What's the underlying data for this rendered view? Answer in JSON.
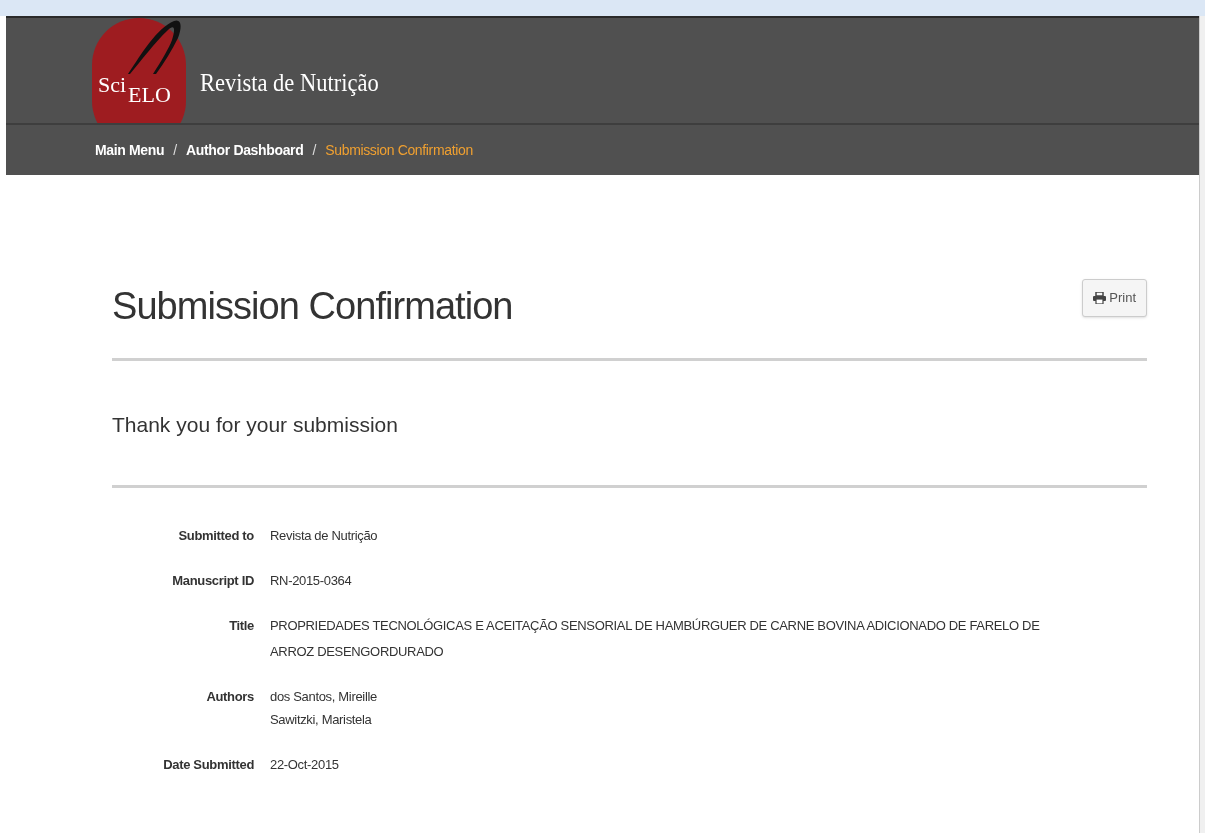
{
  "header": {
    "logo": {
      "part_1": "Sci",
      "part_2": "ELO"
    },
    "journal_title": "Revista de Nutrição"
  },
  "breadcrumb": [
    {
      "label": "Main Menu",
      "current": false
    },
    {
      "label": "Author Dashboard",
      "current": false
    },
    {
      "label": "Submission Confirmation",
      "current": true
    }
  ],
  "breadcrumb_separator": "/",
  "page_title": "Submission Confirmation",
  "print_button": "Print",
  "subtitle": "Thank you for your submission",
  "details": [
    {
      "label": "Submitted to",
      "values": [
        "Revista de Nutrição"
      ]
    },
    {
      "label": "Manuscript ID",
      "values": [
        "RN-2015-0364"
      ]
    },
    {
      "label": "Title",
      "values": [
        "PROPRIEDADES TECNOLÓGICAS E ACEITAÇÃO SENSORIAL DE HAMBÚRGUER DE CARNE BOVINA ADICIONADO DE FARELO DE ARROZ DESENGORDURADO"
      ]
    },
    {
      "label": "Authors",
      "values": [
        "dos Santos, Mireille",
        "Sawitzki, Maristela"
      ]
    },
    {
      "label": "Date Submitted",
      "values": [
        "22-Oct-2015"
      ]
    }
  ]
}
